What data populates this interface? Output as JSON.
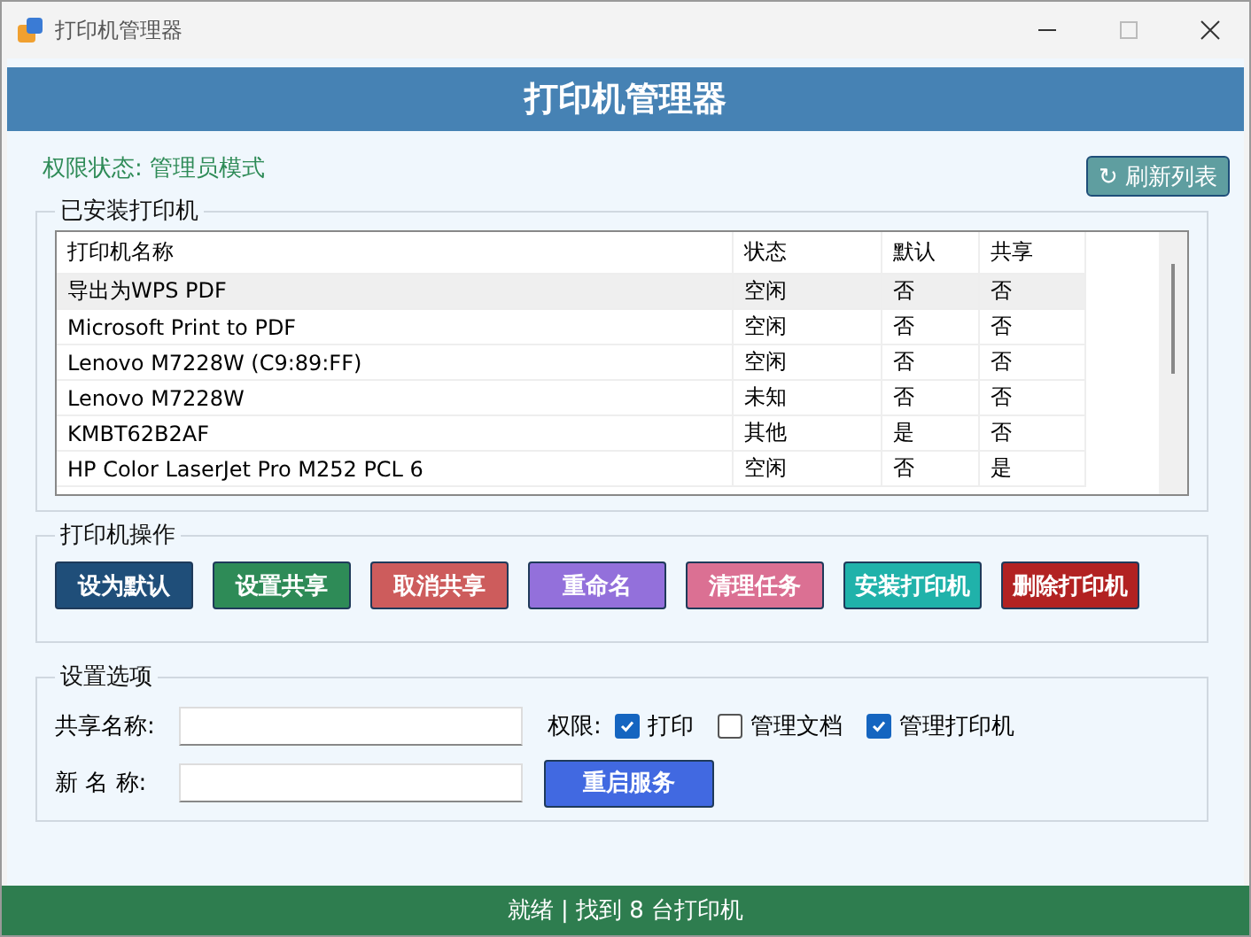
{
  "window": {
    "title": "打印机管理器"
  },
  "header": {
    "title": "打印机管理器"
  },
  "permission_status": "权限状态: 管理员模式",
  "refresh_button": {
    "icon": "↻",
    "label": "刷新列表"
  },
  "installed_group": {
    "title": "已安装打印机",
    "table": {
      "columns": [
        "打印机名称",
        "状态",
        "默认",
        "共享"
      ],
      "rows": [
        {
          "cells": [
            "导出为WPS PDF",
            "空闲",
            "否",
            "否"
          ],
          "selected": true
        },
        {
          "cells": [
            "Microsoft Print to PDF",
            "空闲",
            "否",
            "否"
          ],
          "selected": false
        },
        {
          "cells": [
            "Lenovo M7228W (C9:89:FF)",
            "空闲",
            "否",
            "否"
          ],
          "selected": false
        },
        {
          "cells": [
            "Lenovo M7228W",
            "未知",
            "否",
            "否"
          ],
          "selected": false
        },
        {
          "cells": [
            "KMBT62B2AF",
            "其他",
            "是",
            "否"
          ],
          "selected": false
        },
        {
          "cells": [
            "HP Color LaserJet Pro M252 PCL 6",
            "空闲",
            "否",
            "是"
          ],
          "selected": false
        }
      ]
    }
  },
  "actions_group": {
    "title": "打印机操作",
    "buttons": [
      {
        "label": "设为默认",
        "color": "#1f4e79"
      },
      {
        "label": "设置共享",
        "color": "#2e8b57"
      },
      {
        "label": "取消共享",
        "color": "#cd5c5c"
      },
      {
        "label": "重命名",
        "color": "#9370db"
      },
      {
        "label": "清理任务",
        "color": "#db7093"
      },
      {
        "label": "安装打印机",
        "color": "#20b2aa"
      },
      {
        "label": "删除打印机",
        "color": "#b22222"
      }
    ]
  },
  "settings_group": {
    "title": "设置选项",
    "share_name": {
      "label": "共享名称:"
    },
    "new_name": {
      "label": "新 名 称:"
    },
    "permissions": {
      "label": "权限:",
      "options": [
        {
          "label": "打印",
          "checked": true
        },
        {
          "label": "管理文档",
          "checked": false
        },
        {
          "label": "管理打印机",
          "checked": true
        }
      ]
    },
    "restart_button": "重启服务"
  },
  "status_bar": "就绪 | 找到 8 台打印机"
}
